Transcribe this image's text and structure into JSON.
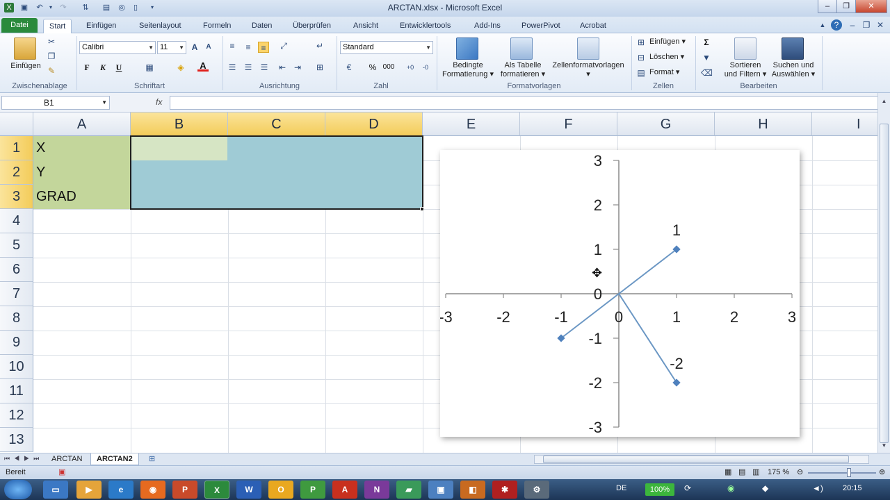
{
  "window": {
    "title": "ARCTAN.xlsx - Microsoft Excel"
  },
  "tabs": [
    "Datei",
    "Start",
    "Einfügen",
    "Seitenlayout",
    "Formeln",
    "Daten",
    "Überprüfen",
    "Ansicht",
    "Entwicklertools",
    "Add-Ins",
    "PowerPivot",
    "Acrobat"
  ],
  "ribbon": {
    "clipboard": {
      "paste": "Einfügen",
      "group": "Zwischenablage"
    },
    "font": {
      "name": "Calibri",
      "size": "11",
      "bold": "F",
      "italic": "K",
      "underline": "U",
      "color_letter": "A",
      "group": "Schriftart"
    },
    "alignment": {
      "group": "Ausrichtung"
    },
    "number": {
      "format": "Standard",
      "percent": "%",
      "thousands": "000",
      "group": "Zahl"
    },
    "styles": {
      "conditional": "Bedingte",
      "conditional2": "Formatierung",
      "as_table": "Als Tabelle",
      "as_table2": "formatieren",
      "cell_styles": "Zellenformatvorlagen",
      "group": "Formatvorlagen"
    },
    "cells": {
      "insert": "Einfügen",
      "delete": "Löschen",
      "format": "Format",
      "group": "Zellen"
    },
    "editing": {
      "sort": "Sortieren",
      "sort2": "und Filtern",
      "find": "Suchen und",
      "find2": "Auswählen",
      "group": "Bearbeiten"
    }
  },
  "formula_bar": {
    "name_box": "B1",
    "fx": "fx",
    "formula": ""
  },
  "columns": [
    "A",
    "B",
    "C",
    "D",
    "E",
    "F",
    "G",
    "H",
    "I"
  ],
  "rows": [
    "1",
    "2",
    "3",
    "4",
    "5",
    "6",
    "7",
    "8",
    "9",
    "10",
    "11",
    "12",
    "13"
  ],
  "cells": {
    "A1": "X",
    "A2": "Y",
    "A3": "GRAD"
  },
  "chart_data": {
    "type": "scatter",
    "title": "",
    "xlim": [
      -3,
      3
    ],
    "ylim": [
      -3,
      3
    ],
    "x_ticks": [
      "-3",
      "-2",
      "-1",
      "0",
      "1",
      "2",
      "3"
    ],
    "y_ticks": [
      "3",
      "2",
      "1",
      "0",
      "-1",
      "-2",
      "-3"
    ],
    "series": [
      {
        "points": [
          {
            "x": 0,
            "y": 0
          },
          {
            "x": 1,
            "y": 1
          }
        ]
      },
      {
        "points": [
          {
            "x": 0,
            "y": 0
          },
          {
            "x": -1,
            "y": -1
          }
        ]
      },
      {
        "points": [
          {
            "x": 0,
            "y": 0
          },
          {
            "x": 1,
            "y": -2
          }
        ]
      }
    ],
    "data_labels": [
      {
        "text": "1",
        "x": 1,
        "y": 1
      },
      {
        "text": "-2",
        "x": 1,
        "y": -2
      }
    ],
    "color": "#6b97c4"
  },
  "sheets": [
    "ARCTAN",
    "ARCTAN2"
  ],
  "status": {
    "ready": "Bereit",
    "zoom": "175 %"
  },
  "taskbar": {
    "lang": "DE",
    "battery": "100%",
    "time": "20:15"
  }
}
